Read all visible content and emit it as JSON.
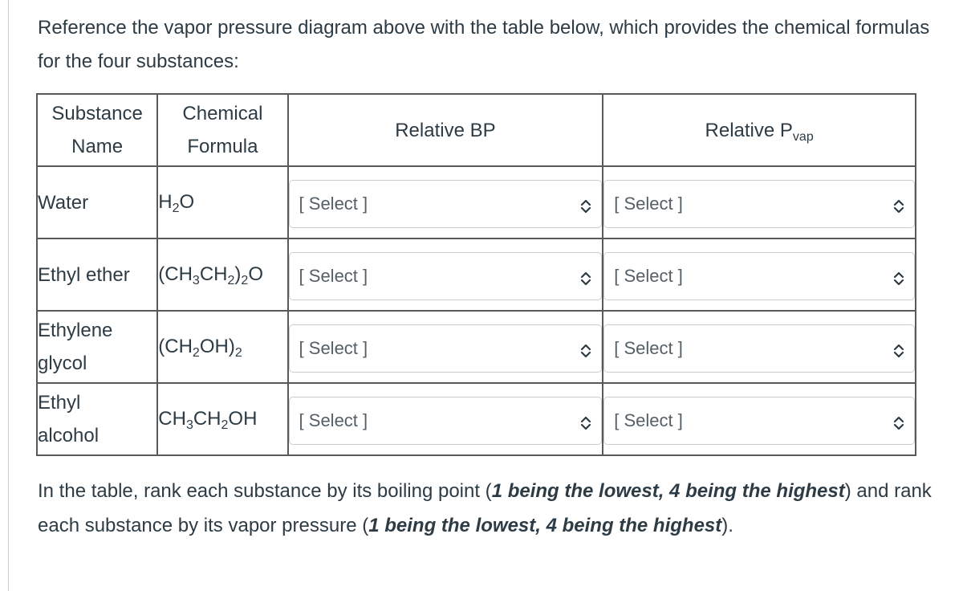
{
  "intro_text": "Reference the vapor pressure diagram above with the table below, which provides the chemical formulas for the four substances:",
  "table": {
    "headers": {
      "substance_line1": "Substance",
      "substance_line2": "Name",
      "formula_line1": "Chemical",
      "formula_line2": "Formula",
      "bp": "Relative BP",
      "pvap_main": "Relative P",
      "pvap_sub": "vap"
    },
    "rows": [
      {
        "name_line1": "Water",
        "name_line2": "",
        "formula_parts": [
          "H",
          "2",
          "O"
        ],
        "bp_select": "[ Select ]",
        "pvap_select": "[ Select ]"
      },
      {
        "name_line1": "Ethyl ether",
        "name_line2": "",
        "formula_parts": [
          "(CH",
          "3",
          "CH",
          "2",
          ")",
          "2",
          "O"
        ],
        "bp_select": "[ Select ]",
        "pvap_select": "[ Select ]"
      },
      {
        "name_line1": "Ethylene",
        "name_line2": "glycol",
        "formula_parts": [
          "(CH",
          "2",
          "OH)",
          "2"
        ],
        "bp_select": "[ Select ]",
        "pvap_select": "[ Select ]"
      },
      {
        "name_line1": "Ethyl",
        "name_line2": "alcohol",
        "formula_parts": [
          "CH",
          "3",
          "CH",
          "2",
          "OH"
        ],
        "bp_select": "[ Select ]",
        "pvap_select": "[ Select ]"
      }
    ],
    "select_icon": "chevron-up-down-icon"
  },
  "instructions": {
    "part1": "In the table, rank each substance by its boiling point (",
    "bold1": "1 being the lowest, 4 being the highest",
    "part2": ") and rank each substance by its vapor pressure (",
    "bold2": "1 being the lowest, 4 being the highest",
    "part3": ")."
  }
}
